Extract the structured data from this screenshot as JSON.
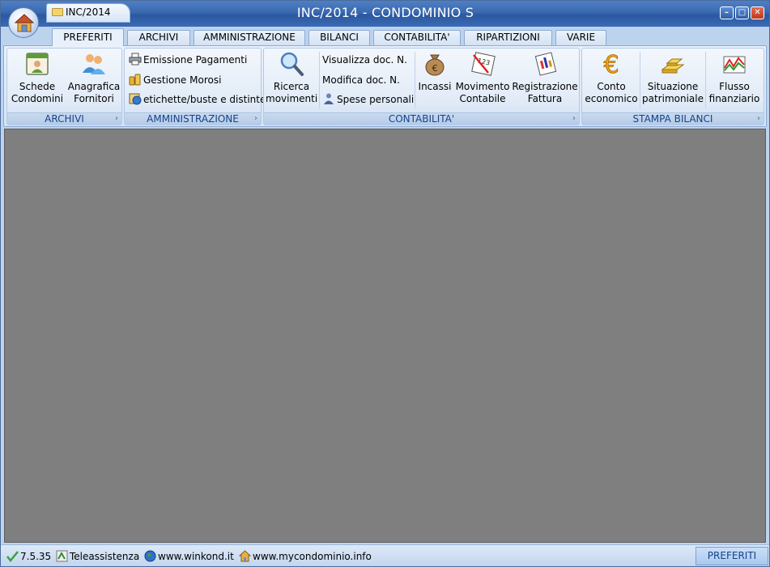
{
  "window": {
    "title": "INC/2014 - CONDOMINIO S",
    "doc_tab": "INC/2014"
  },
  "tabs": [
    {
      "label": "PREFERITI",
      "active": true
    },
    {
      "label": "ARCHIVI"
    },
    {
      "label": "AMMINISTRAZIONE"
    },
    {
      "label": "BILANCI"
    },
    {
      "label": "CONTABILITA'"
    },
    {
      "label": "RIPARTIZIONI"
    },
    {
      "label": "VARIE"
    }
  ],
  "ribbon": {
    "archivi": {
      "label": "ARCHIVI",
      "schede_l1": "Schede",
      "schede_l2": "Condomini",
      "anagrafica_l1": "Anagrafica",
      "anagrafica_l2": "Fornitori"
    },
    "amministrazione": {
      "label": "AMMINISTRAZIONE",
      "emissione": "Emissione Pagamenti",
      "morosi": "Gestione Morosi",
      "etichette": "etichette/buste e distinte"
    },
    "contabilita": {
      "label": "CONTABILITA'",
      "ricerca_l1": "Ricerca",
      "ricerca_l2": "movimenti",
      "visualizza": "Visualizza doc. N.",
      "modifica": "Modifica doc. N.",
      "spese": "Spese personali",
      "incassi": "Incassi",
      "movimento_l1": "Movimento",
      "movimento_l2": "Contabile",
      "registrazione_l1": "Registrazione",
      "registrazione_l2": "Fattura"
    },
    "stampa": {
      "label": "STAMPA BILANCI",
      "conto_l1": "Conto",
      "conto_l2": "economico",
      "situazione_l1": "Situazione",
      "situazione_l2": "patrimoniale",
      "flusso_l1": "Flusso",
      "flusso_l2": "finanziario"
    }
  },
  "status": {
    "version": "7.5.35",
    "teleassistenza": "Teleassistenza",
    "site1": "www.winkond.it",
    "site2": "www.mycondominio.info",
    "current_tab": "PREFERITI"
  },
  "colors": {
    "title_bar": "#3a69b0",
    "workspace": "#7f7f7f",
    "ribbon": "#dce8f7"
  }
}
